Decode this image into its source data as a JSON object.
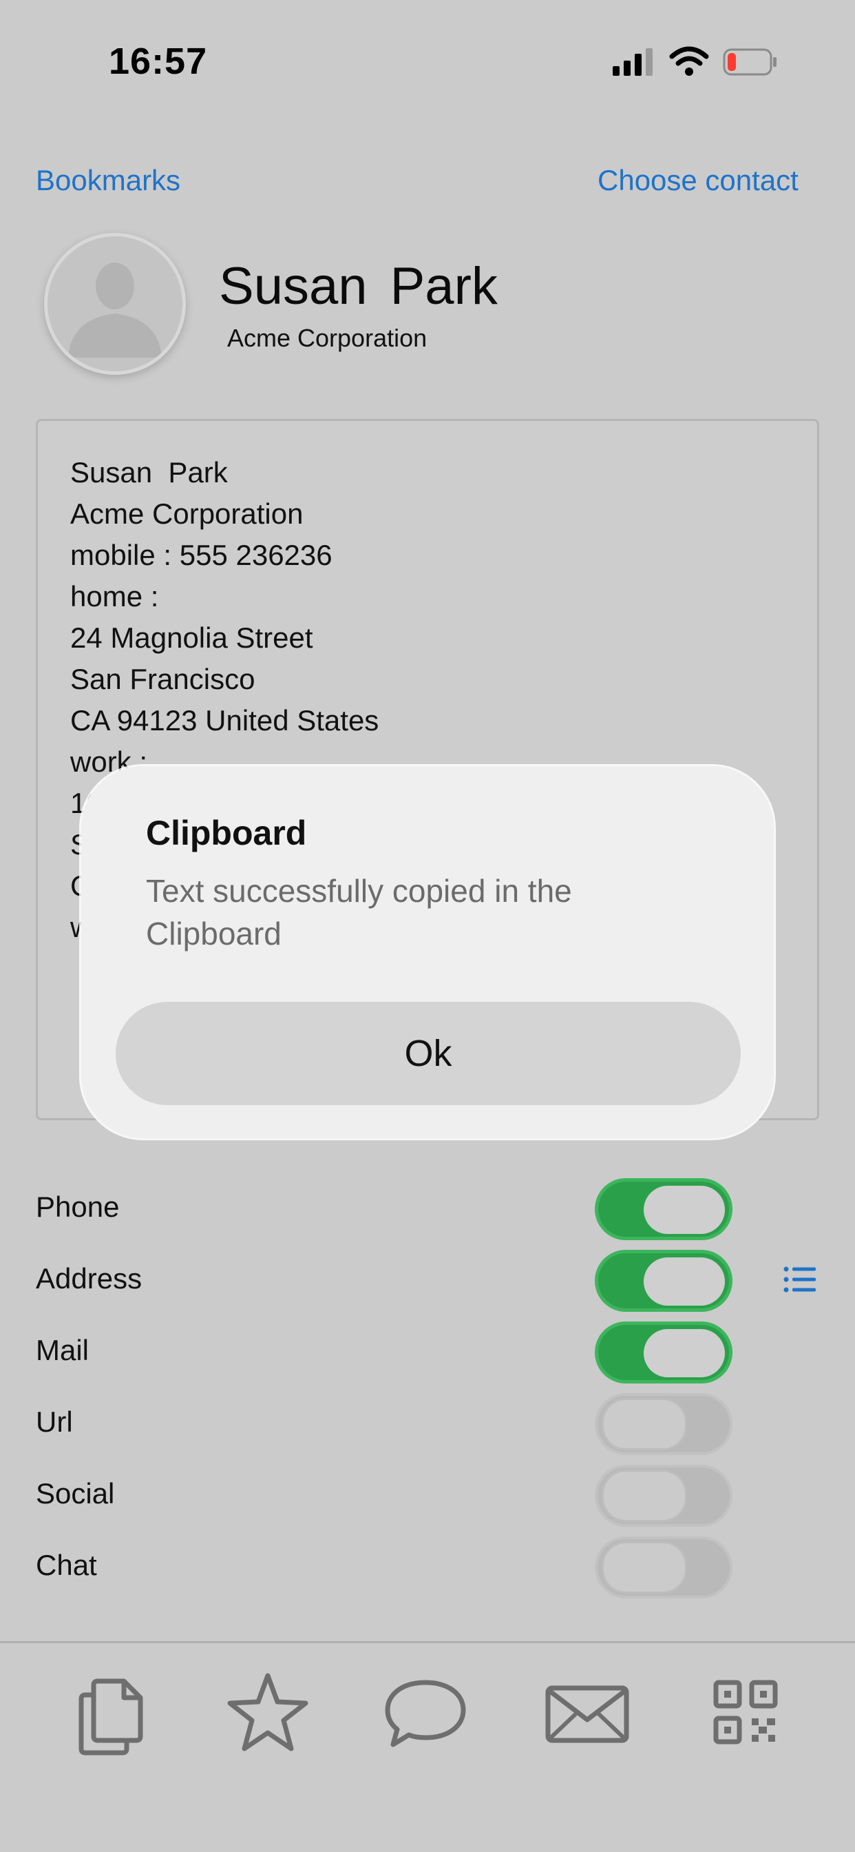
{
  "status_bar": {
    "time": "16:57"
  },
  "header": {
    "bookmarks_link": "Bookmarks",
    "choose_contact_link": "Choose contact"
  },
  "contact": {
    "name": "Susan  Park",
    "company": "Acme Corporation"
  },
  "card": {
    "lines": [
      "Susan  Park",
      "Acme Corporation",
      "mobile : 555 236236",
      "home :",
      "24 Magnolia Street",
      "San Francisco",
      "CA 94123 United States",
      "work :",
      "10",
      "S",
      "C",
      "w"
    ]
  },
  "toggles": [
    {
      "label": "Phone",
      "on": true
    },
    {
      "label": "Address",
      "on": true
    },
    {
      "label": "Mail",
      "on": true
    },
    {
      "label": "Url",
      "on": false
    },
    {
      "label": "Social",
      "on": false
    },
    {
      "label": "Chat",
      "on": false
    }
  ],
  "tab_bar": {
    "icons": [
      "copy-icon",
      "star-icon",
      "chat-bubble-icon",
      "mail-icon",
      "qr-code-icon"
    ]
  },
  "dialog": {
    "title": "Clipboard",
    "message": "Text successfully copied in the Clipboard",
    "ok_label": "Ok"
  },
  "colors": {
    "accent": "#1e73c9",
    "toggle_on": "#2aa04a",
    "background": "#cbcbcb"
  }
}
